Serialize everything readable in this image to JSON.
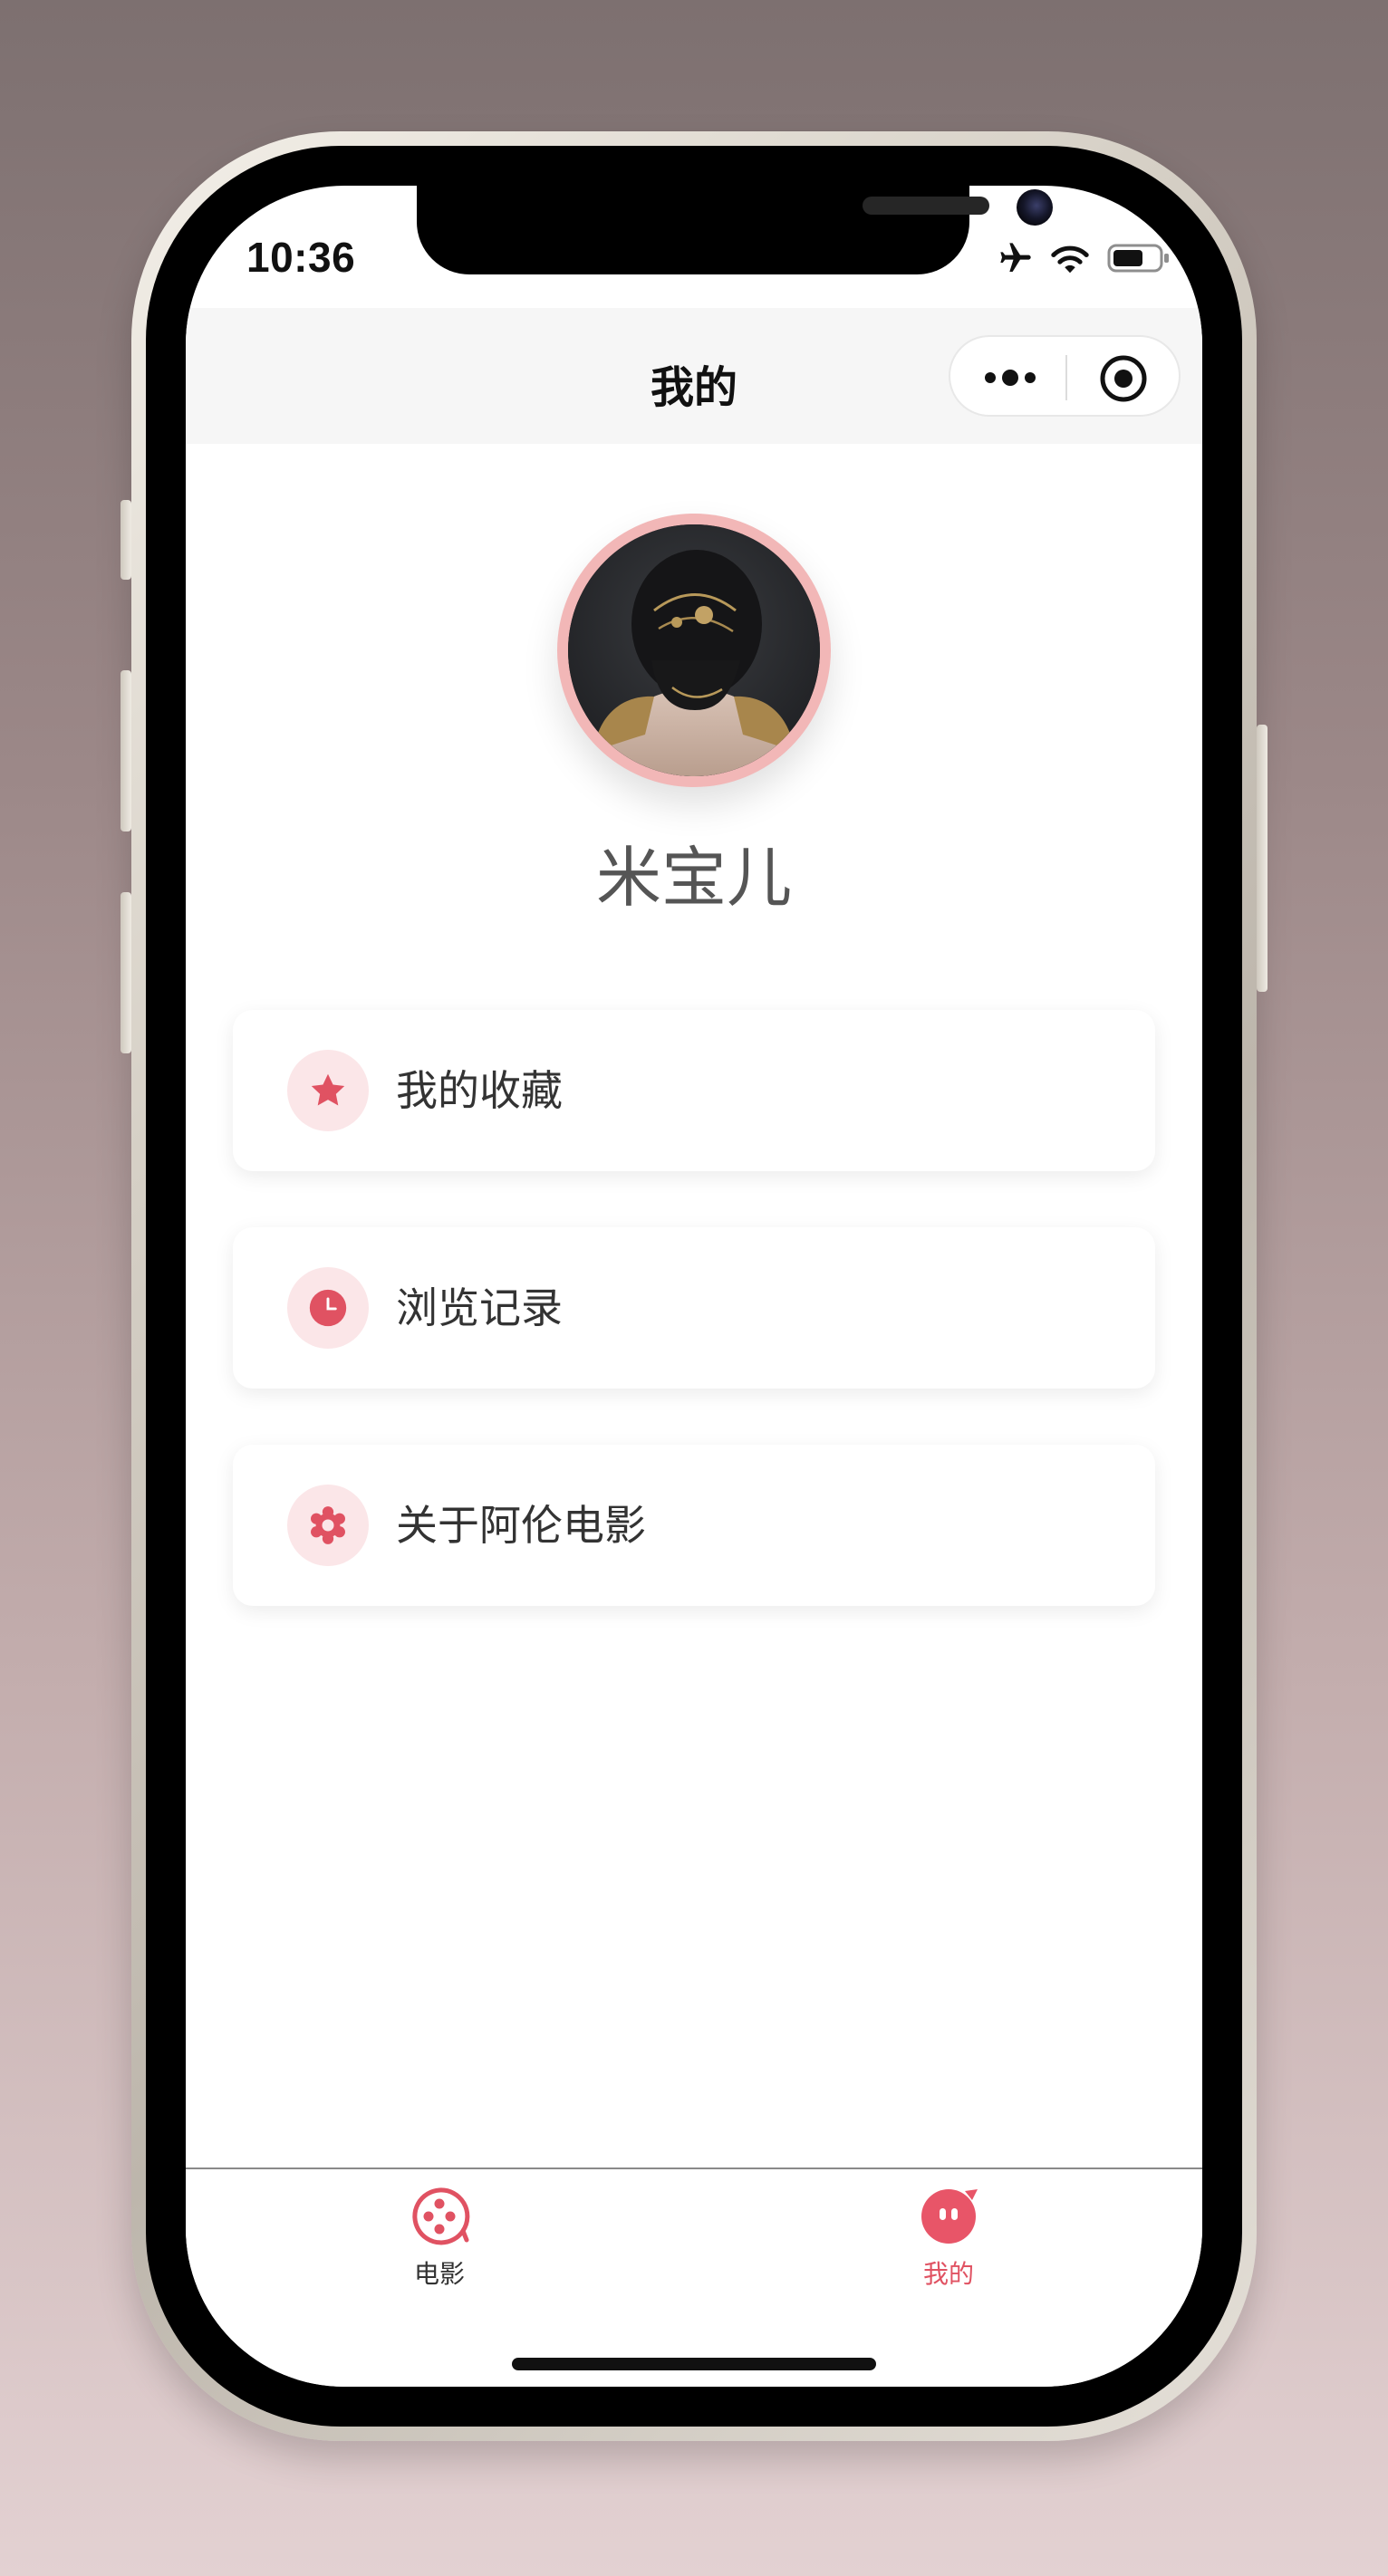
{
  "status_bar": {
    "time": "10:36"
  },
  "nav": {
    "title": "我的"
  },
  "profile": {
    "username": "米宝儿"
  },
  "menu": [
    {
      "label": "我的收藏",
      "icon": "star-icon"
    },
    {
      "label": "浏览记录",
      "icon": "clock-icon"
    },
    {
      "label": "关于阿伦电影",
      "icon": "gear-icon"
    }
  ],
  "tabs": [
    {
      "label": "电影",
      "icon": "film-reel-icon",
      "active": false
    },
    {
      "label": "我的",
      "icon": "profile-bubble-icon",
      "active": true
    }
  ],
  "colors": {
    "accent": "#e05262",
    "accent_light": "#fbe6e8",
    "avatar_ring": "#f2b7b7",
    "tab_inactive": "#333333",
    "nav_bg": "#f6f6f6"
  }
}
